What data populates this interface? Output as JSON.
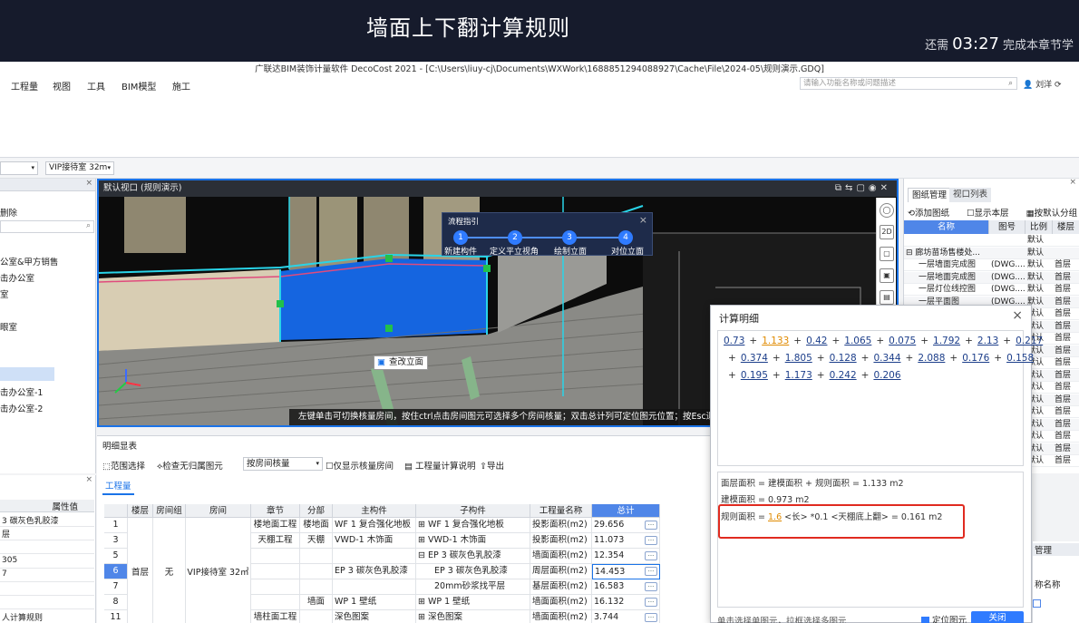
{
  "video": {
    "title": "墙面上下翻计算规则",
    "remaining_prefix": "还需",
    "remaining_time": "03:27",
    "remaining_suffix": "完成本章节学"
  },
  "app": {
    "title": "广联达BIM装饰计量软件 DecoCost 2021 - [C:\\Users\\liuy-cj\\Documents\\WXWork\\1688851294088927\\Cache\\File\\2024-05\\规则演示.GDQ]",
    "menu": [
      "工程量",
      "视图",
      "工具",
      "BIM模型",
      "施工"
    ],
    "search_placeholder": "请输入功能名称或问题描述",
    "user": "刘洋"
  },
  "selector": {
    "floor": "",
    "room": "VIP接待室 32m"
  },
  "left_panel": {
    "delete_label": "删除",
    "items": [
      "公室&甲方销售",
      "击办公室",
      "室",
      "眼室",
      "击办公室-1",
      "击办公室-2"
    ]
  },
  "left_props": {
    "header": "属性值",
    "rows": [
      "3 碳灰色乳胶漆",
      "层",
      "",
      "305",
      "7",
      "",
      "",
      "人计算规则"
    ]
  },
  "viewport": {
    "title": "默认视口 (规则演示)",
    "status": "左键单击可切换核量房间，按住ctrl点击房间图元可选择多个房间核量；双击总计列可定位图元位置；按Esc退出",
    "change_elevation": "查改立面"
  },
  "guide": {
    "title": "流程指引",
    "steps": [
      {
        "num": "1",
        "label": "新建构件"
      },
      {
        "num": "2",
        "label": "定义平立视角"
      },
      {
        "num": "3",
        "label": "绘制立面"
      },
      {
        "num": "4",
        "label": "对位立面"
      }
    ]
  },
  "right_panel": {
    "tabs": [
      "图纸管理",
      "视口列表"
    ],
    "tools": [
      "添加图纸",
      "显示本层",
      "按默认分组"
    ],
    "columns": [
      "名称",
      "图号",
      "比例",
      "楼层"
    ],
    "rows": [
      {
        "name": "",
        "no": "",
        "scale": "默认",
        "floor": ""
      },
      {
        "name": "⊟ 廊坊苗场售楼处...",
        "no": "",
        "scale": "默认",
        "floor": ""
      },
      {
        "name": "一层墙面完成图",
        "no": "(DWG....",
        "scale": "默认",
        "floor": "首层"
      },
      {
        "name": "一层地面完成图",
        "no": "(DWG....",
        "scale": "默认",
        "floor": "首层"
      },
      {
        "name": "一层灯位线控图",
        "no": "(DWG....",
        "scale": "默认",
        "floor": "首层"
      },
      {
        "name": "一层平面图",
        "no": "(DWG....",
        "scale": "默认",
        "floor": "首层"
      },
      {
        "name": "",
        "no": "",
        "scale": "默认",
        "floor": "首层"
      },
      {
        "name": "",
        "no": "",
        "scale": "默认",
        "floor": "首层"
      },
      {
        "name": "",
        "no": "",
        "scale": "默认",
        "floor": "首层"
      },
      {
        "name": "",
        "no": "",
        "scale": "默认",
        "floor": "首层"
      },
      {
        "name": "",
        "no": "",
        "scale": "默认",
        "floor": "首层"
      },
      {
        "name": "",
        "no": "",
        "scale": "默认",
        "floor": "首层"
      },
      {
        "name": "",
        "no": "",
        "scale": "默认",
        "floor": "首层"
      },
      {
        "name": "",
        "no": "",
        "scale": "默认",
        "floor": "首层"
      },
      {
        "name": "",
        "no": "",
        "scale": "默认",
        "floor": "首层"
      },
      {
        "name": "",
        "no": "",
        "scale": "默认",
        "floor": "首层"
      },
      {
        "name": "",
        "no": "",
        "scale": "默认",
        "floor": "首层"
      },
      {
        "name": "",
        "no": "",
        "scale": "默认",
        "floor": "首层"
      },
      {
        "name": "",
        "no": "",
        "scale": "默认",
        "floor": "首层"
      }
    ]
  },
  "detail": {
    "title": "明细显表",
    "tools": [
      "范围选择",
      "检查无归属图元",
      "仅显示核量房间",
      "工程量计算说明",
      "导出"
    ],
    "mode": "按房间核量",
    "tab": "工程量",
    "columns": [
      "",
      "楼层",
      "房间组",
      "房间",
      "章节",
      "分部",
      "主构件",
      "子构件",
      "工程量名称",
      "总计"
    ],
    "floor": "首层",
    "room_group": "无",
    "room": "VIP接待室 32㎡",
    "rows": [
      {
        "no": "1",
        "chapter": "楼地面工程",
        "part": "楼地面",
        "main": "WF 1 复合强化地板",
        "sub": "⊞ WF 1 复合强化地板",
        "qty": "投影面积(m2)",
        "total": "29.656"
      },
      {
        "no": "3",
        "chapter": "天棚工程",
        "part": "天棚",
        "main": "VWD-1 木饰面",
        "sub": "⊞ VWD-1 木饰面",
        "qty": "投影面积(m2)",
        "total": "11.073"
      },
      {
        "no": "5",
        "chapter": "",
        "part": "",
        "main": "",
        "sub": "⊟ EP 3 碳灰色乳胶漆",
        "qty": "墙面面积(m2)",
        "total": "12.354"
      },
      {
        "no": "6",
        "chapter": "",
        "part": "",
        "main": "EP 3 碳灰色乳胶漆",
        "sub": "EP 3 碳灰色乳胶漆",
        "qty": "周层面积(m2)",
        "total": "14.453"
      },
      {
        "no": "7",
        "chapter": "",
        "part": "",
        "main": "",
        "sub": "20mm砂浆找平层",
        "qty": "基层面积(m2)",
        "total": "16.583"
      },
      {
        "no": "8",
        "chapter": "",
        "part": "墙面",
        "main": "WP 1 壁纸",
        "sub": "⊞ WP 1 壁纸",
        "qty": "墙面面积(m2)",
        "total": "16.132"
      },
      {
        "no": "11",
        "chapter": "墙柱面工程",
        "part": "",
        "main": "深色图案",
        "sub": "⊞ 深色图案",
        "qty": "墙面面积(m2)",
        "total": "3.744"
      }
    ]
  },
  "calc": {
    "title": "计算明细",
    "line1": [
      "0.73",
      "1.133",
      "0.42",
      "1.065",
      "0.075",
      "1.792",
      "2.13",
      "0.217"
    ],
    "line2": [
      "0.374",
      "1.805",
      "0.128",
      "0.344",
      "2.088",
      "0.176",
      "0.158"
    ],
    "line3": [
      "0.195",
      "1.173",
      "0.242",
      "0.206"
    ],
    "formula_surface": "面层面积 = 建模面积 + 规则面积 = 1.133 m2",
    "formula_model": "建模面积 = 0.973 m2",
    "formula_rule_prefix": "规则面积 =",
    "formula_rule_value": "1.6",
    "formula_rule_suffix": "<长> *0.1 <天棚底上翻> = 0.161 m2",
    "footer": "单击选择单图元，拉框选择多图元",
    "locate": "定位图元",
    "close": "关闭"
  },
  "bottom_right": {
    "tab": "管理",
    "head": "称名称"
  }
}
